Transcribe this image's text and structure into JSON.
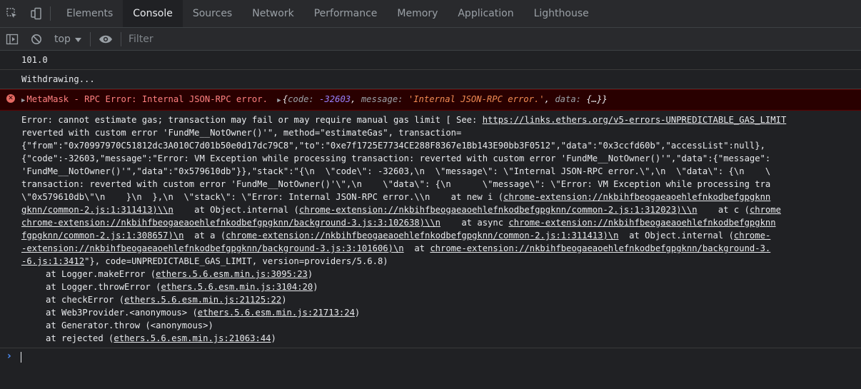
{
  "tabs": [
    "Elements",
    "Console",
    "Sources",
    "Network",
    "Performance",
    "Memory",
    "Application",
    "Lighthouse"
  ],
  "active_tab": "Console",
  "toolbar": {
    "context": "top",
    "filter_placeholder": "Filter"
  },
  "messages": {
    "m1": "101.0",
    "m2": "Withdrawing..."
  },
  "error_row": {
    "text": "MetaMask - RPC Error: Internal JSON-RPC error.",
    "obj": {
      "open": "{",
      "k1": "code: ",
      "v1": "-32603",
      "c1": ", ",
      "k2": "message: ",
      "v2": "'Internal JSON-RPC error.'",
      "c2": ", ",
      "k3": "data: ",
      "v3": "{…}",
      "close": "}"
    }
  },
  "error_body": {
    "l1a": "Error: cannot estimate gas; transaction may fail or may require manual gas limit [ See: ",
    "l1b": "https://links.ethers.org/v5-errors-UNPREDICTABLE_GAS_LIMIT",
    "l2": "reverted with custom error 'FundMe__NotOwner()'\", method=\"estimateGas\", transaction=",
    "l3": "{\"from\":\"0x70997970C51812dc3A010C7d01b50e0d17dc79C8\",\"to\":\"0xe7f1725E7734CE288F8367e1Bb143E90bb3F0512\",\"data\":\"0x3ccfd60b\",\"accessList\":null},",
    "l4": "{\"code\":-32603,\"message\":\"Error: VM Exception while processing transaction: reverted with custom error 'FundMe__NotOwner()'\",\"data\":{\"message\":",
    "l5": "'FundMe__NotOwner()'\",\"data\":\"0x579610db\"}},\"stack\":\"{\\n  \\\"code\\\": -32603,\\n  \\\"message\\\": \\\"Internal JSON-RPC error.\\\",\\n  \\\"data\\\": {\\n    \\",
    "l6": "transaction: reverted with custom error 'FundMe__NotOwner()'\\\",\\n    \\\"data\\\": {\\n      \\\"message\\\": \\\"Error: VM Exception while processing tra",
    "l7a": "\\\"0x579610db\\\"\\n    }\\n  },\\n  \\\"stack\\\": \\\"Error: Internal JSON-RPC error.\\\\n    at new i (",
    "l7b": "chrome-extension://nkbihfbeogaeaoehlefnkodbefgpgknn",
    "l8a": "gknn/common-2.js:1:311413)\\\\n",
    "l8b": "    at Object.internal (",
    "l8c": "chrome-extension://nkbihfbeogaeaoehlefnkodbefgpgknn/common-2.js:1:312023)\\\\n",
    "l8d": "    at c (",
    "l8e": "chrome",
    "l9a": "chrome-extension://nkbihfbeogaeaoehlefnkodbefgpgknn/background-3.js:3:102638)\\\\n",
    "l9b": "    at async ",
    "l9c": "chrome-extension://nkbihfbeogaeaoehlefnkodbefgpgknn",
    "l10a": "fgpgknn/common-2.js:1:308657)\\n",
    "l10b": "  at a (",
    "l10c": "chrome-extension://nkbihfbeogaeaoehlefnkodbefgpgknn/common-2.js:1:311413)\\n",
    "l10d": "  at Object.internal (",
    "l10e": "chrome-",
    "l11a": "-extension://nkbihfbeogaeaoehlefnkodbefgpgknn/background-3.js:3:101606)\\n",
    "l11b": "  at ",
    "l11c": "chrome-extension://nkbihfbeogaeaoehlefnkodbefgpgknn/background-3.",
    "l12a": "-6.js:1:3412",
    "l12b": "\"}, code=UNPREDICTABLE_GAS_LIMIT, version=providers/5.6.8)",
    "stack": [
      {
        "pre": "at Logger.makeError (",
        "link": "ethers.5.6.esm.min.js:3095:23",
        "post": ")"
      },
      {
        "pre": "at Logger.throwError (",
        "link": "ethers.5.6.esm.min.js:3104:20",
        "post": ")"
      },
      {
        "pre": "at checkError (",
        "link": "ethers.5.6.esm.min.js:21125:22",
        "post": ")"
      },
      {
        "pre": "at Web3Provider.<anonymous> (",
        "link": "ethers.5.6.esm.min.js:21713:24",
        "post": ")"
      },
      {
        "pre": "at Generator.throw (<anonymous>)",
        "link": "",
        "post": ""
      },
      {
        "pre": "at rejected (",
        "link": "ethers.5.6.esm.min.js:21063:44",
        "post": ")"
      }
    ]
  }
}
